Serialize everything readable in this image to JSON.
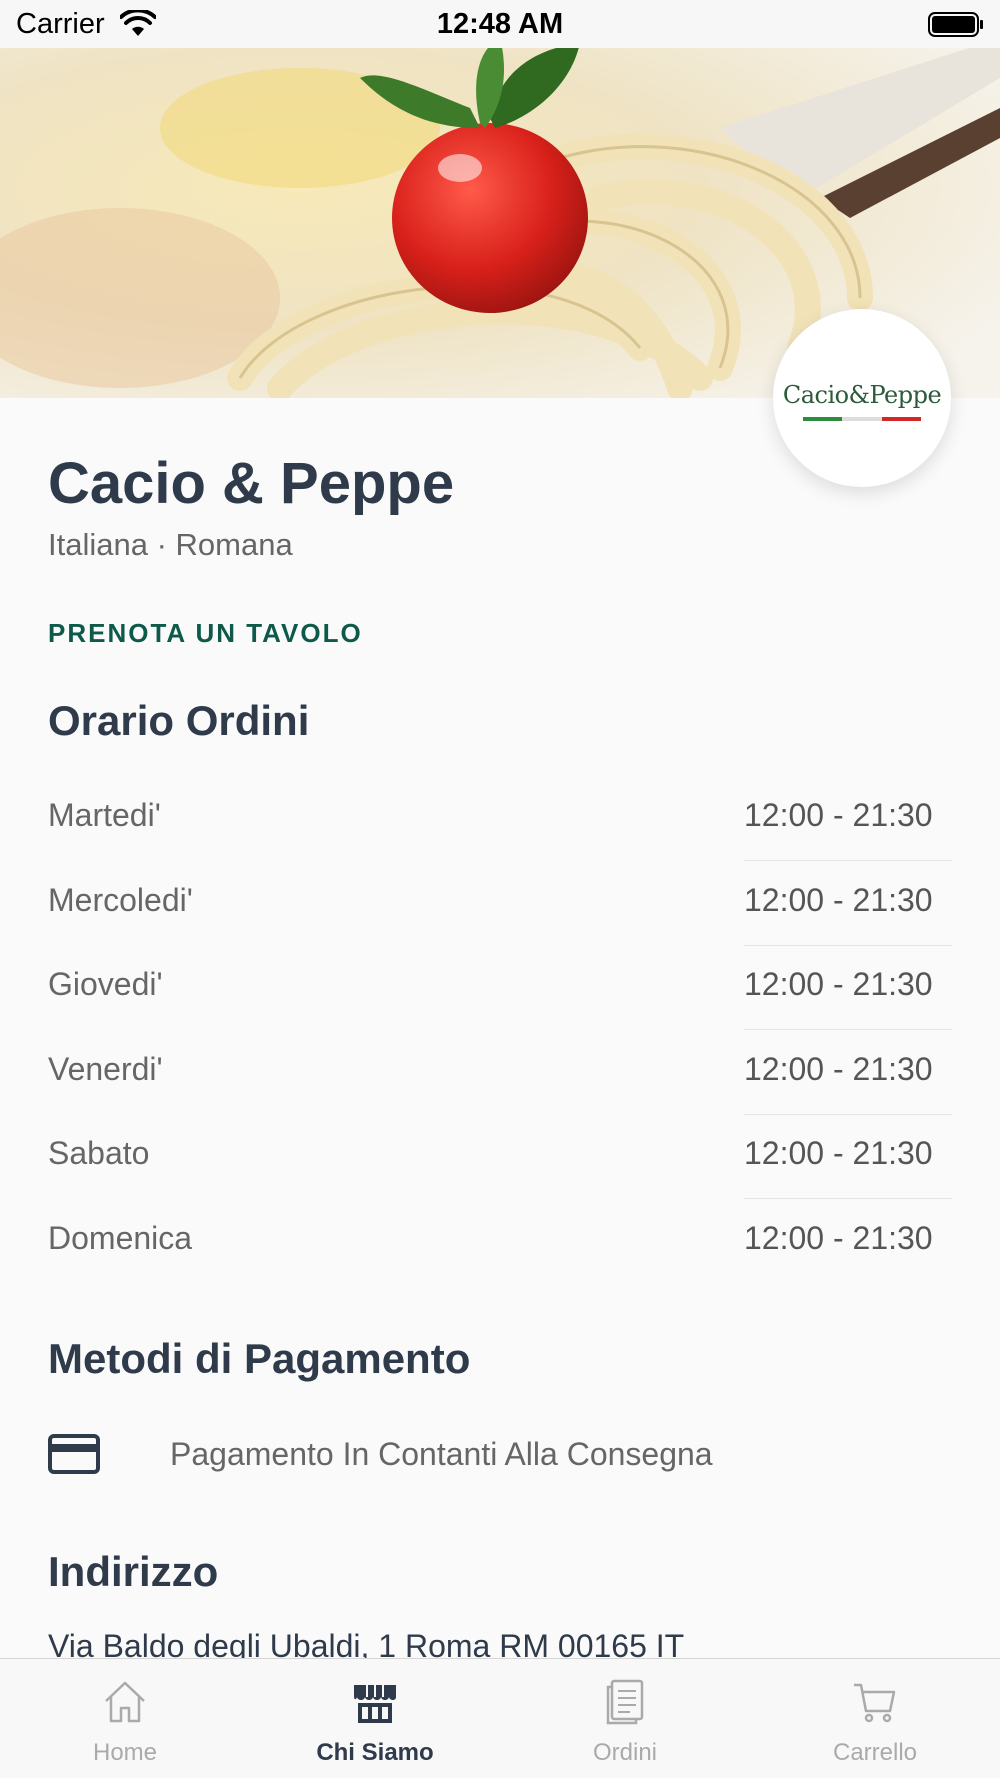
{
  "status_bar": {
    "carrier": "Carrier",
    "time": "12:48 AM"
  },
  "restaurant": {
    "name": "Cacio & Peppe",
    "cuisine": "Italiana · Romana",
    "logo_text": "Cacio&Peppe",
    "reserve_label": "PRENOTA UN TAVOLO"
  },
  "hours_section": {
    "title": "Orario Ordini",
    "rows": [
      {
        "day": "Martedi'",
        "time": "12:00 - 21:30"
      },
      {
        "day": "Mercoledi'",
        "time": "12:00 - 21:30"
      },
      {
        "day": "Giovedi'",
        "time": "12:00 - 21:30"
      },
      {
        "day": "Venerdi'",
        "time": "12:00 - 21:30"
      },
      {
        "day": "Sabato",
        "time": "12:00 - 21:30"
      },
      {
        "day": "Domenica",
        "time": "12:00 - 21:30"
      }
    ]
  },
  "payment_section": {
    "title": "Metodi di Pagamento",
    "method": "Pagamento In Contanti Alla Consegna",
    "icon": "credit-card-icon"
  },
  "address_section": {
    "title": "Indirizzo",
    "address": "Via Baldo degli Ubaldi, 1 Roma RM 00165 IT"
  },
  "tab_bar": {
    "tabs": [
      {
        "label": "Home",
        "icon": "home-icon",
        "active": false
      },
      {
        "label": "Chi Siamo",
        "icon": "store-icon",
        "active": true
      },
      {
        "label": "Ordini",
        "icon": "orders-icon",
        "active": false
      },
      {
        "label": "Carrello",
        "icon": "cart-icon",
        "active": false
      }
    ]
  },
  "colors": {
    "accent": "#0d5a4a",
    "text": "#2f3a4a",
    "muted": "#666666"
  }
}
